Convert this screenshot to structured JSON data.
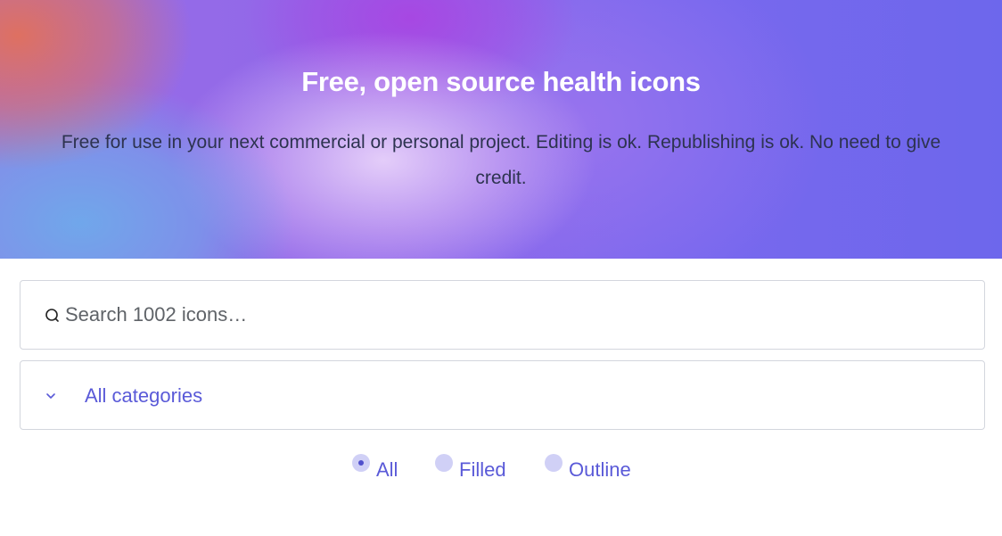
{
  "hero": {
    "title": "Free, open source health icons",
    "subtitle": "Free for use in your next commercial or personal project. Editing is ok. Republishing is ok. No need to give credit."
  },
  "search": {
    "placeholder": "Search 1002 icons…",
    "value": "",
    "icon": "search-icon"
  },
  "category_select": {
    "selected": "All categories",
    "icon": "chevron-down-icon"
  },
  "style_filter": {
    "options": [
      {
        "label": "All",
        "checked": true
      },
      {
        "label": "Filled",
        "checked": false
      },
      {
        "label": "Outline",
        "checked": false
      }
    ]
  },
  "colors": {
    "accent": "#5a5ad8",
    "radio_bg": "#d0d0f6",
    "border": "#d3d6dd",
    "hero_text": "#ffffff",
    "hero_subtext": "#2d3350"
  }
}
